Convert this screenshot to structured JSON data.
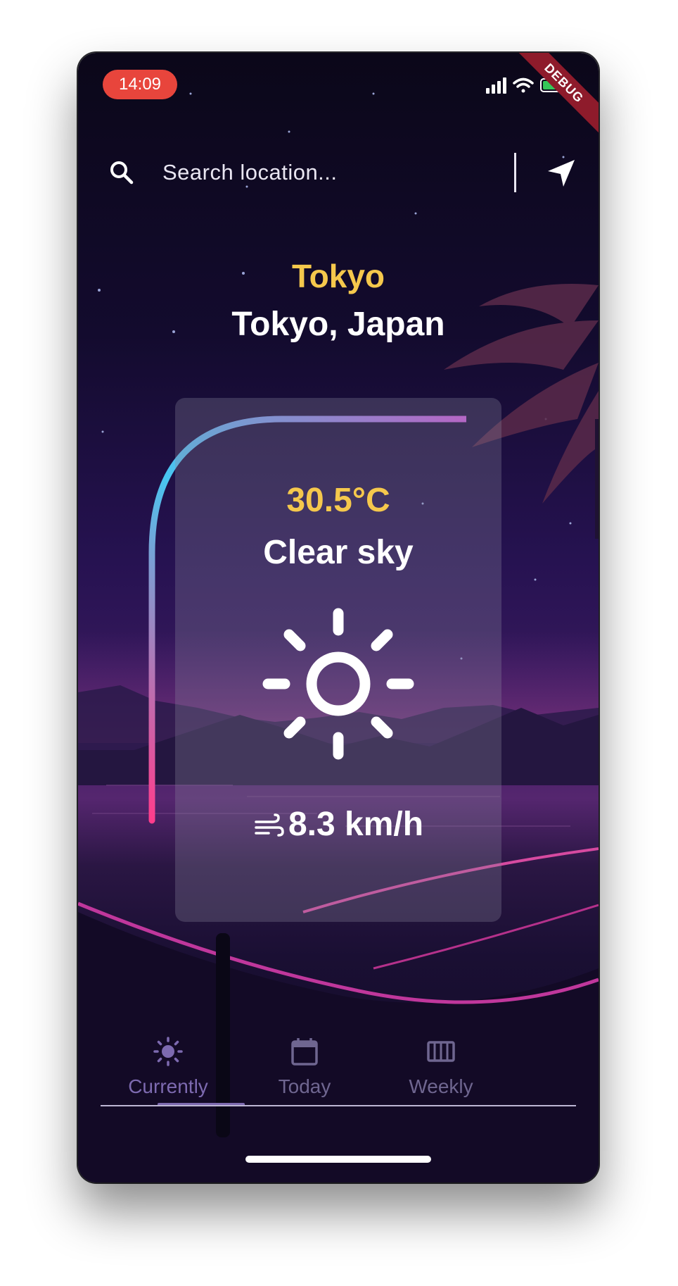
{
  "status_bar": {
    "time": "14:09",
    "debug_banner": "DEBUG"
  },
  "search": {
    "placeholder": "Search location..."
  },
  "location": {
    "city": "Tokyo",
    "region": "Tokyo, Japan"
  },
  "weather": {
    "temperature": "30.5°C",
    "condition": "Clear sky",
    "wind": "8.3 km/h",
    "icon": "sun-icon"
  },
  "tabs": [
    {
      "label": "Currently",
      "icon": "sun-icon",
      "selected": true
    },
    {
      "label": "Today",
      "icon": "calendar-icon",
      "selected": false
    },
    {
      "label": "Weekly",
      "icon": "calendar-view-week-icon",
      "selected": false
    }
  ],
  "colors": {
    "accent": "#f5c84c",
    "tab_selected": "#7d6ab0",
    "tab_unselected": "#6f6690",
    "status_pill": "#e8453c"
  }
}
